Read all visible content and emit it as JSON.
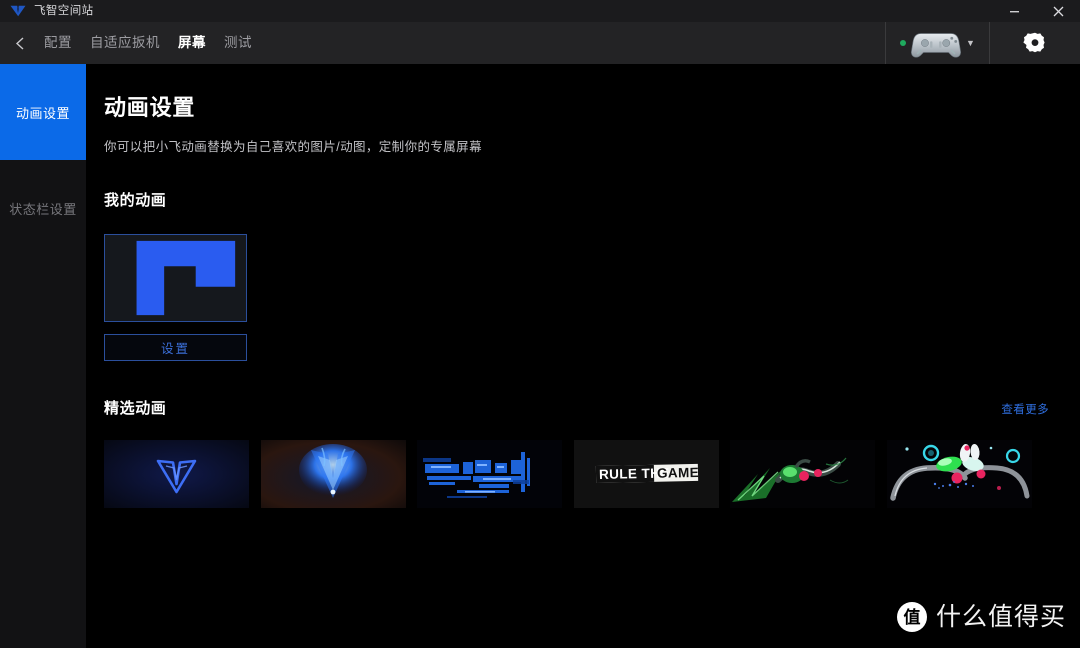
{
  "window": {
    "app_title": "飞智空间站",
    "logo_icon": "flydigi-v-logo",
    "minimize_label": "—",
    "close_label": "✕"
  },
  "nav": {
    "back_icon": "chevron-left-icon",
    "tabs": [
      {
        "label": "配置",
        "active": false
      },
      {
        "label": "自适应扳机",
        "active": false
      },
      {
        "label": "屏幕",
        "active": true
      },
      {
        "label": "测试",
        "active": false
      }
    ],
    "device": {
      "status_dot_color": "#1faa5e",
      "controller_icon": "gamepad-icon",
      "dropdown_icon": "chevron-down-icon"
    },
    "settings_icon": "gear-icon"
  },
  "sidebar": {
    "items": [
      {
        "label": "动画设置",
        "active": true
      },
      {
        "label": "状态栏设置",
        "active": false
      }
    ]
  },
  "main": {
    "title": "动画设置",
    "subtitle": "你可以把小飞动画替换为自己喜欢的图片/动图，定制你的专属屏幕",
    "my_animation": {
      "heading": "我的动画",
      "thumbnail_icon": "blue-hook-shape-thumbnail",
      "settings_button": "设置"
    },
    "featured": {
      "heading": "精选动画",
      "more_link": "查看更多",
      "cards": [
        {
          "name": "flydigi-v-logo-blue",
          "caption": ""
        },
        {
          "name": "blue-flame-v",
          "caption": ""
        },
        {
          "name": "blue-glitch-circuit",
          "caption": ""
        },
        {
          "name": "rule-the-game",
          "caption": "RULE THE GAME"
        },
        {
          "name": "green-neon-creature",
          "caption": ""
        },
        {
          "name": "neon-abstract-tentacles",
          "caption": ""
        }
      ]
    }
  },
  "watermark": {
    "badge": "值",
    "text": "什么值得买"
  },
  "colors": {
    "accent_blue": "#0b6ae8",
    "link_blue": "#2f6fe0",
    "status_green": "#1faa5e",
    "titlebar_bg": "#1b1b1d",
    "navbar_bg": "#232325",
    "sidebar_bg": "#121214",
    "page_bg": "#000000"
  }
}
